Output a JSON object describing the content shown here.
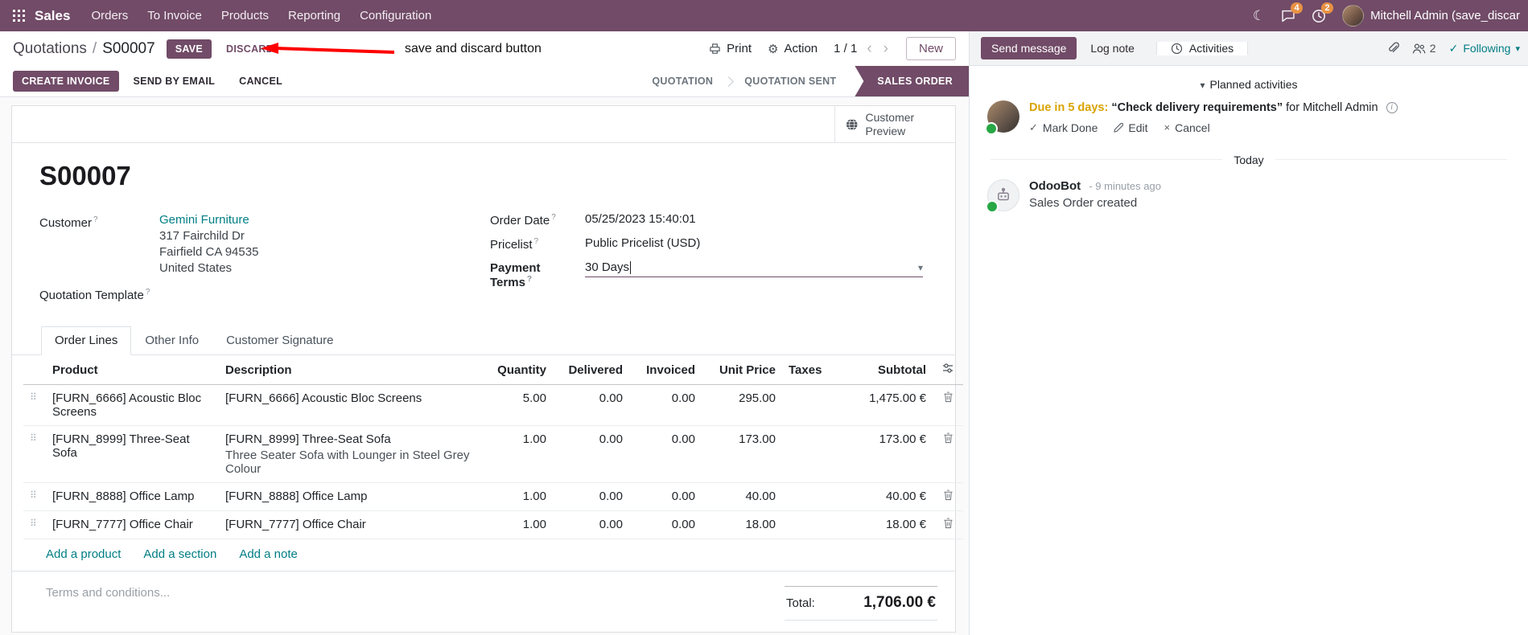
{
  "colors": {
    "brand": "#714B67",
    "link": "#017e84",
    "edited_value": "#2160c4",
    "due_warning": "#d9a300",
    "following": "#017e84",
    "annotation_arrow": "#ff0000",
    "badge": "#e79144"
  },
  "icons": {
    "gear": "⚙",
    "chevron_left": "‹",
    "chevron_right": "›",
    "caret_down": "▾",
    "check": "✓",
    "close": "×",
    "moon": "☾",
    "info": "i",
    "drag_handle": "⠿",
    "help": "?"
  },
  "navbar": {
    "brand": "Sales",
    "menus": [
      "Orders",
      "To Invoice",
      "Products",
      "Reporting",
      "Configuration"
    ],
    "messages_badge": "4",
    "activities_badge": "2",
    "user": "Mitchell Admin (save_discar"
  },
  "control_panel": {
    "breadcrumb": {
      "parent": "Quotations",
      "separator": "/",
      "current": "S00007"
    },
    "save": "SAVE",
    "discard": "DISCARD",
    "annotation": "save and discard button",
    "print": "Print",
    "action": "Action",
    "pager": "1 / 1",
    "new": "New"
  },
  "statusbar": {
    "create_invoice": "CREATE INVOICE",
    "send_by_email": "SEND BY EMAIL",
    "cancel": "CANCEL",
    "steps": [
      "QUOTATION",
      "QUOTATION SENT",
      "SALES ORDER"
    ],
    "active_step": "SALES ORDER"
  },
  "form": {
    "preview_label": "Customer Preview",
    "title": "S00007",
    "customer": {
      "label": "Customer",
      "name": "Gemini Furniture",
      "address1": "317 Fairchild Dr",
      "address2": "Fairfield CA 94535",
      "address3": "United States"
    },
    "quotation_template_label": "Quotation Template",
    "order_date": {
      "label": "Order Date",
      "value": "05/25/2023 15:40:01"
    },
    "pricelist": {
      "label": "Pricelist",
      "value": "Public Pricelist (USD)"
    },
    "payment_terms": {
      "label": "Payment Terms",
      "value": "30 Days"
    },
    "tabs": [
      "Order Lines",
      "Other Info",
      "Customer Signature"
    ],
    "active_tab": "Order Lines",
    "table": {
      "headers": {
        "product": "Product",
        "description": "Description",
        "quantity": "Quantity",
        "delivered": "Delivered",
        "invoiced": "Invoiced",
        "unit_price": "Unit Price",
        "taxes": "Taxes",
        "subtotal": "Subtotal"
      },
      "rows": [
        {
          "product": "[FURN_6666] Acoustic Bloc Screens",
          "description": "[FURN_6666] Acoustic Bloc Screens",
          "description2": "",
          "quantity": "5.00",
          "delivered": "0.00",
          "invoiced": "0.00",
          "unit_price": "295.00",
          "taxes": "",
          "subtotal": "1,475.00 €"
        },
        {
          "product": "[FURN_8999] Three-Seat Sofa",
          "description": "[FURN_8999] Three-Seat Sofa",
          "description2": "Three Seater Sofa with Lounger in Steel Grey Colour",
          "quantity": "1.00",
          "delivered": "0.00",
          "invoiced": "0.00",
          "unit_price": "173.00",
          "taxes": "",
          "subtotal": "173.00 €"
        },
        {
          "product": "[FURN_8888] Office Lamp",
          "description": "[FURN_8888] Office Lamp",
          "description2": "",
          "quantity": "1.00",
          "delivered": "0.00",
          "invoiced": "0.00",
          "unit_price": "40.00",
          "taxes": "",
          "subtotal": "40.00 €"
        },
        {
          "product": "[FURN_7777] Office Chair",
          "description": "[FURN_7777] Office Chair",
          "description2": "",
          "quantity": "1.00",
          "delivered": "0.00",
          "invoiced": "0.00",
          "unit_price": "18.00",
          "taxes": "",
          "subtotal": "18.00 €"
        }
      ]
    },
    "add_product": "Add a product",
    "add_section": "Add a section",
    "add_note": "Add a note",
    "terms_placeholder": "Terms and conditions...",
    "total_label": "Total:",
    "total_value": "1,706.00 €"
  },
  "chatter": {
    "send_message": "Send message",
    "log_note": "Log note",
    "activities_tab": "Activities",
    "followers_count": "2",
    "following": "Following",
    "planned_activities": "Planned activities",
    "activity": {
      "due": "Due in 5 days:",
      "summary": "“Check delivery requirements”",
      "assignee": "for Mitchell Admin",
      "mark_done": "Mark Done",
      "edit": "Edit",
      "cancel": "Cancel"
    },
    "date_divider": "Today",
    "message": {
      "author": "OdooBot",
      "time": "- 9 minutes ago",
      "body": "Sales Order created"
    }
  }
}
